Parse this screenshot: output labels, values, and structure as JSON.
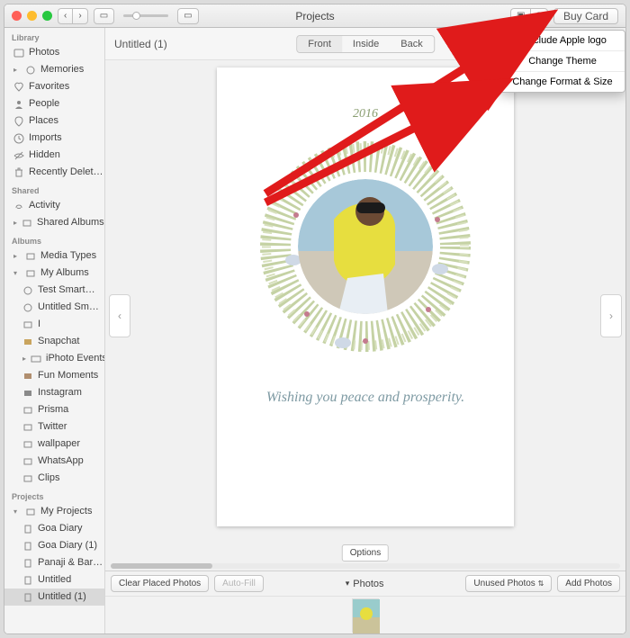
{
  "titlebar": {
    "title": "Projects",
    "buy_label": "Buy Card"
  },
  "sidebar": {
    "sections": [
      {
        "header": "Library",
        "items": [
          {
            "label": "Photos"
          },
          {
            "label": "Memories"
          },
          {
            "label": "Favorites"
          },
          {
            "label": "People"
          },
          {
            "label": "Places"
          },
          {
            "label": "Imports"
          },
          {
            "label": "Hidden"
          },
          {
            "label": "Recently Delet…"
          }
        ]
      },
      {
        "header": "Shared",
        "items": [
          {
            "label": "Activity"
          },
          {
            "label": "Shared Albums"
          }
        ]
      },
      {
        "header": "Albums",
        "items": [
          {
            "label": "Media Types"
          },
          {
            "label": "My Albums"
          },
          {
            "label": "Test Smart…"
          },
          {
            "label": "Untitled Sm…"
          },
          {
            "label": "I"
          },
          {
            "label": "Snapchat"
          },
          {
            "label": "iPhoto Events"
          },
          {
            "label": "Fun Moments"
          },
          {
            "label": "Instagram"
          },
          {
            "label": "Prisma"
          },
          {
            "label": "Twitter"
          },
          {
            "label": "wallpaper"
          },
          {
            "label": "WhatsApp"
          },
          {
            "label": "Clips"
          }
        ]
      },
      {
        "header": "Projects",
        "items": [
          {
            "label": "My Projects"
          },
          {
            "label": "Goa Diary"
          },
          {
            "label": "Goa Diary (1)"
          },
          {
            "label": "Panaji & Bar…"
          },
          {
            "label": "Untitled"
          },
          {
            "label": "Untitled (1)"
          }
        ]
      }
    ]
  },
  "document": {
    "name": "Untitled (1)",
    "tabs": {
      "front": "Front",
      "inside": "Inside",
      "back": "Back"
    },
    "year": "2016",
    "wish": "Wishing you peace and prosperity.",
    "options_label": "Options"
  },
  "bottom": {
    "clear": "Clear Placed Photos",
    "autofill": "Auto-Fill",
    "photos_label": "Photos",
    "unused": "Unused Photos",
    "add": "Add Photos"
  },
  "dropdown": {
    "include_logo": "Include Apple logo",
    "change_theme": "Change Theme",
    "change_format": "Change Format & Size"
  }
}
